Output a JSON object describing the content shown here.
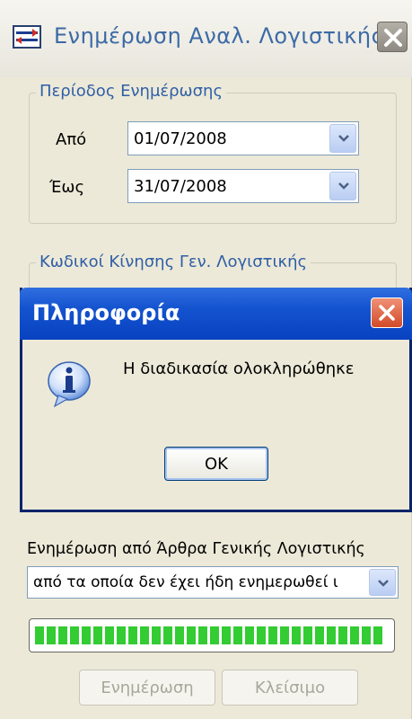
{
  "window": {
    "title": "Ενημέρωση Αναλ. Λογιστικής"
  },
  "period_group": {
    "legend": "Περίοδος Ενημέρωσης",
    "from_label": "Από",
    "from_value": "01/07/2008",
    "to_label": "Έως",
    "to_value": "31/07/2008"
  },
  "codes_group": {
    "legend": "Κωδικοί Κίνησης Γεν. Λογιστικής"
  },
  "dialog": {
    "title": "Πληροφορία",
    "message": "Η διαδικασία ολοκληρώθηκε",
    "ok_label": "OK"
  },
  "update_from": {
    "label": "Ενημέρωση από Άρθρα Γενικής Λογιστικής",
    "value": "από τα οποία δεν έχει ήδη ενημερωθεί ι"
  },
  "progress": {
    "fraction": 1.0,
    "color": "#33cc33"
  },
  "buttons": {
    "update_label": "Ενημέρωση",
    "close_label": "Κλείσιμο"
  }
}
